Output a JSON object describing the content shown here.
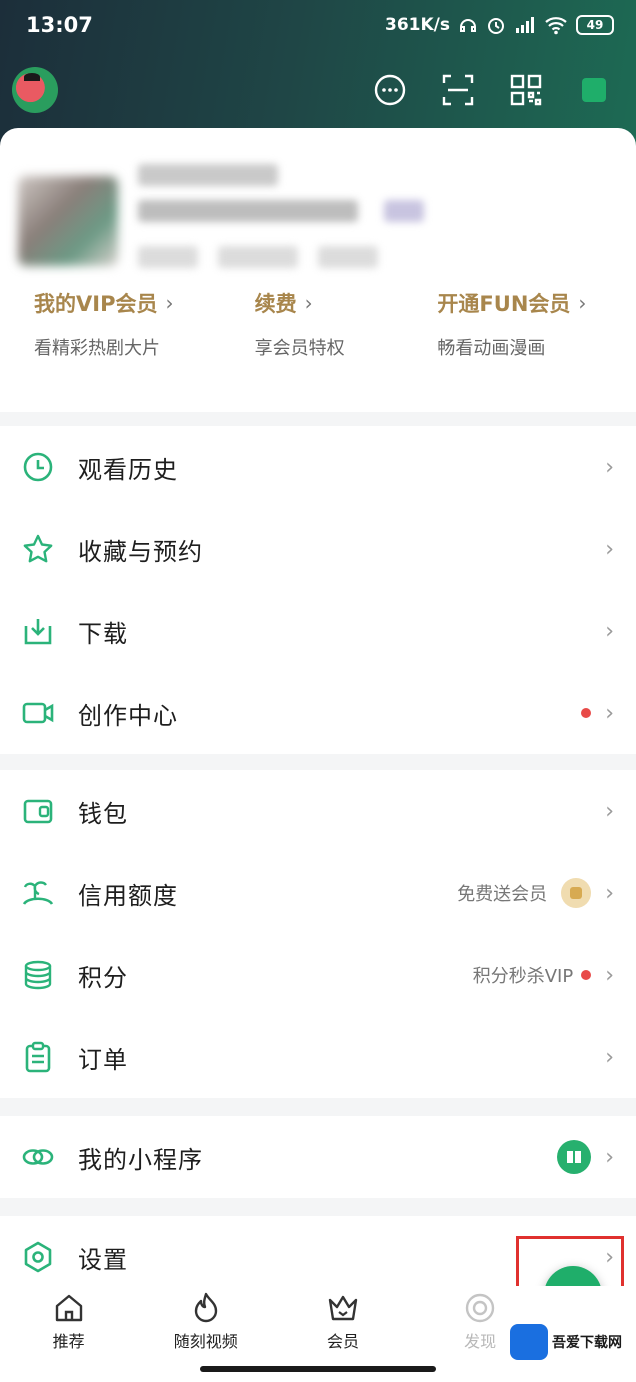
{
  "status": {
    "time": "13:07",
    "speed": "361K/s",
    "battery": "49"
  },
  "vip": [
    {
      "title": "我的VIP会员",
      "sub": "看精彩热剧大片"
    },
    {
      "title": "续费",
      "sub": "享会员特权"
    },
    {
      "title": "开通FUN会员",
      "sub": "畅看动画漫画"
    }
  ],
  "menu": {
    "history": "观看历史",
    "favorites": "收藏与预约",
    "download": "下载",
    "creator": "创作中心",
    "wallet": "钱包",
    "credit": "信用额度",
    "credit_extra": "免费送会员",
    "points": "积分",
    "points_extra": "积分秒杀VIP",
    "orders": "订单",
    "miniapps": "我的小程序",
    "settings": "设置"
  },
  "chevron": "›",
  "tabs": [
    "推荐",
    "随刻视频",
    "会员",
    "发现"
  ],
  "watermark": "吾爱下载网",
  "colors": {
    "accent": "#2bb37a",
    "gold": "#a8864c",
    "badge_red": "#e84a48"
  }
}
